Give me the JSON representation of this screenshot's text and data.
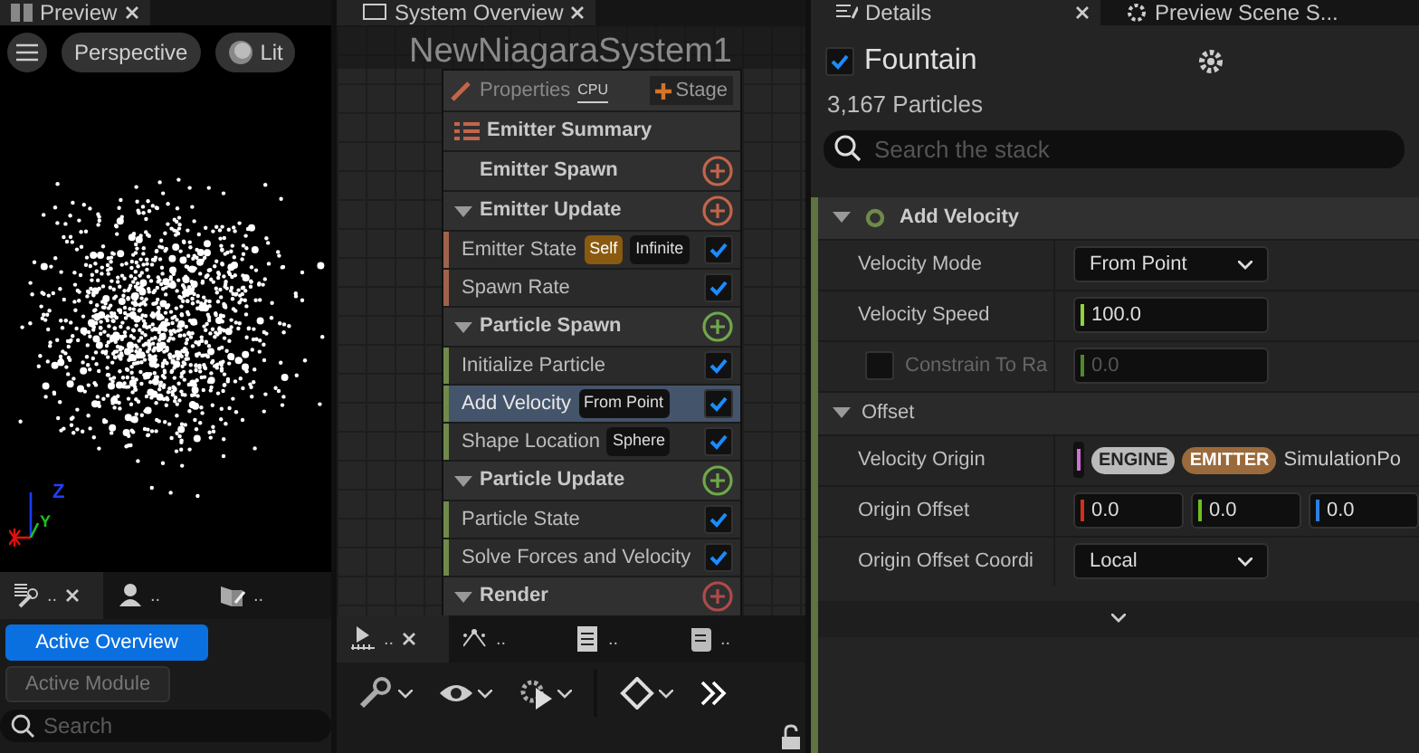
{
  "preview_panel": {
    "tab": {
      "label": "Preview",
      "selected": true
    },
    "toolbar": {
      "view_mode": "Perspective",
      "lighting": "Lit"
    },
    "axis_labels": {
      "z": "Z",
      "y": "Y"
    }
  },
  "tools_panel": {
    "tabs": [
      {
        "label": "..",
        "selected": true,
        "closable": true
      },
      {
        "label": "..",
        "selected": false,
        "closable": false
      },
      {
        "label": "..",
        "selected": false,
        "closable": false
      }
    ],
    "buttons": [
      {
        "label": "Active Overview",
        "selected": true
      },
      {
        "label": "Active Module",
        "selected": false
      }
    ],
    "search": {
      "placeholder": "Search"
    }
  },
  "system_overview": {
    "tab": {
      "label": "System Overview",
      "selected": true
    },
    "title": "NewNiagaraSystem1",
    "node_header": {
      "properties": "Properties",
      "target": "CPU",
      "stage": "Stage"
    },
    "stack": [
      {
        "kind": "summary",
        "label": "Emitter Summary"
      },
      {
        "kind": "group",
        "label": "Emitter Spawn",
        "color": "#c4654a"
      },
      {
        "kind": "group",
        "label": "Emitter Update",
        "expanded": true,
        "color": "#c4654a"
      },
      {
        "kind": "module",
        "label": "Emitter State",
        "color": "#a0624a",
        "checked": true,
        "selected": false,
        "tags": [
          {
            "text": "Self",
            "kind": "scope"
          },
          {
            "text": "Infinite",
            "kind": "value"
          }
        ]
      },
      {
        "kind": "module",
        "label": "Spawn Rate",
        "color": "#a0624a",
        "checked": true,
        "selected": false
      },
      {
        "kind": "group",
        "label": "Particle Spawn",
        "expanded": true,
        "color": "#6fa84a"
      },
      {
        "kind": "module",
        "label": "Initialize Particle",
        "color": "#6f8a4a",
        "checked": true,
        "selected": false
      },
      {
        "kind": "module",
        "label": "Add Velocity",
        "color": "#6f8a4a",
        "checked": true,
        "selected": true,
        "tags": [
          {
            "text": "From Point",
            "kind": "value"
          }
        ]
      },
      {
        "kind": "module",
        "label": "Shape Location",
        "color": "#6f8a4a",
        "checked": true,
        "selected": false,
        "tags": [
          {
            "text": "Sphere",
            "kind": "value"
          }
        ]
      },
      {
        "kind": "group",
        "label": "Particle Update",
        "expanded": true,
        "color": "#6fa84a"
      },
      {
        "kind": "module",
        "label": "Particle State",
        "color": "#6f8a4a",
        "checked": true,
        "selected": false
      },
      {
        "kind": "module",
        "label": "Solve Forces and Velocity",
        "color": "#6f8a4a",
        "checked": true,
        "selected": false
      },
      {
        "kind": "group",
        "label": "Render",
        "expanded": true,
        "color": "#b04a4a"
      }
    ]
  },
  "graph_tools_panel": {
    "tabs": [
      {
        "label": "..",
        "selected": true,
        "closable": true
      },
      {
        "label": "..",
        "selected": false,
        "closable": false
      },
      {
        "label": "..",
        "selected": false,
        "closable": false
      },
      {
        "label": "..",
        "selected": false,
        "closable": false
      }
    ]
  },
  "details_panel": {
    "tabs": [
      {
        "label": "Details",
        "selected": true,
        "closable": true
      },
      {
        "label": "Preview Scene S...",
        "selected": false,
        "closable": false
      }
    ],
    "emitter": {
      "name": "Fountain",
      "enabled": true,
      "particle_count": "3,167 Particles"
    },
    "search": {
      "placeholder": "Search the stack"
    },
    "module": {
      "label": "Add Velocity",
      "expanded": true
    },
    "rows": [
      {
        "kind": "dropdown",
        "label": "Velocity Mode",
        "value": "From Point"
      },
      {
        "kind": "number",
        "label": "Velocity Speed",
        "value": "100.0",
        "color": "#8fd43a",
        "disabled": false
      },
      {
        "kind": "number",
        "label": "Constrain To Ra",
        "value": "0.0",
        "color": "#4e8a2a",
        "disabled": true,
        "checked": false
      },
      {
        "kind": "section",
        "label": "Offset",
        "expanded": true
      },
      {
        "kind": "binding",
        "label": "Velocity Origin",
        "color": "#d070d8",
        "chips": [
          {
            "text": "ENGINE",
            "kind": "engine"
          },
          {
            "text": "EMITTER",
            "kind": "emitter"
          }
        ],
        "value": "SimulationPo"
      },
      {
        "kind": "vector",
        "label": "Origin Offset",
        "components": [
          {
            "value": "0.0",
            "color": "#d0301c"
          },
          {
            "value": "0.0",
            "color": "#6cc020"
          },
          {
            "value": "0.0",
            "color": "#2c7fe0"
          }
        ]
      },
      {
        "kind": "dropdown",
        "label": "Origin Offset Coordi",
        "value": "Local"
      }
    ]
  }
}
